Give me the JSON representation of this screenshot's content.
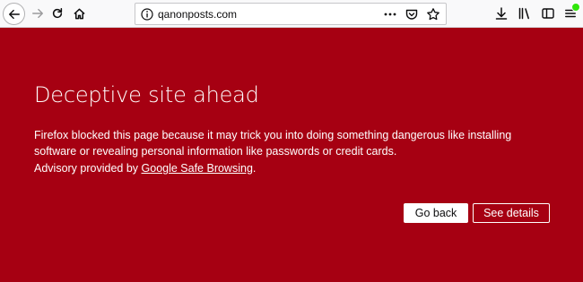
{
  "browser": {
    "url": "qanonposts.com",
    "icons": {
      "back": "arrow-left-icon",
      "forward": "arrow-right-icon",
      "reload": "reload-icon",
      "home": "home-icon",
      "info": "info-icon",
      "page_actions": "more-dots-icon",
      "pocket": "pocket-icon",
      "bookmark": "star-icon",
      "downloads": "download-icon",
      "library": "library-icon",
      "sidebar": "sidebar-icon",
      "menu": "hamburger-menu-icon"
    }
  },
  "warning": {
    "title": "Deceptive site ahead",
    "description": "Firefox blocked this page because it may trick you into doing something dangerous like installing software or revealing personal information like passwords or credit cards.",
    "advisory_prefix": "Advisory provided by ",
    "advisory_link": "Google Safe Browsing",
    "advisory_suffix": ".",
    "go_back_label": "Go back",
    "see_details_label": "See details"
  },
  "colors": {
    "background": "#a60012",
    "text": "#ffffff",
    "toolbar": "#f9f9fa",
    "update_badge": "#30e60b"
  }
}
